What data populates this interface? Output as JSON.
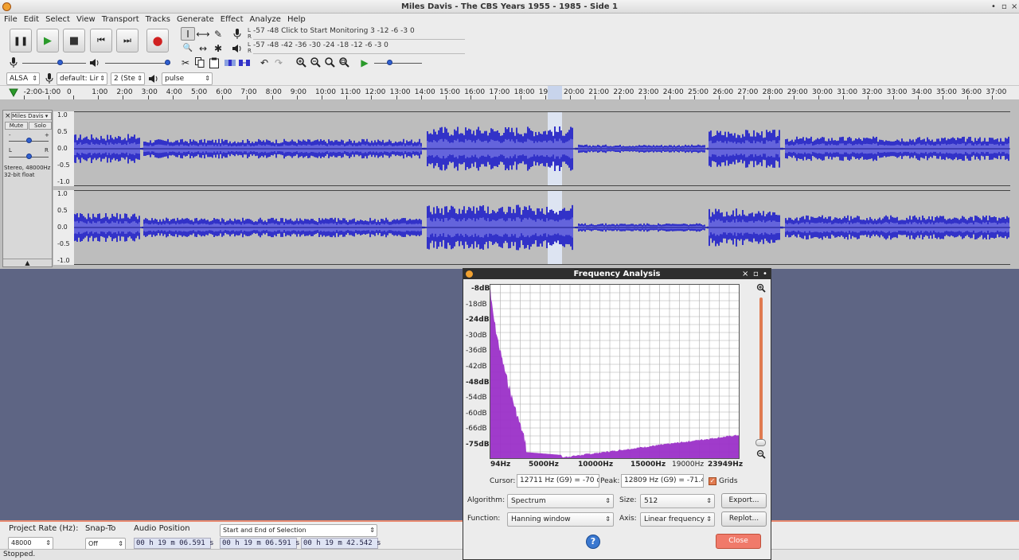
{
  "window": {
    "title": "Miles Davis - The CBS Years 1955 - 1985 - Side 1",
    "controls": [
      "•",
      "▫",
      "×"
    ]
  },
  "menu": [
    "File",
    "Edit",
    "Select",
    "View",
    "Transport",
    "Tracks",
    "Generate",
    "Effect",
    "Analyze",
    "Help"
  ],
  "transport": {
    "pause": "❚❚",
    "play": "▶",
    "stop": "■",
    "skip_start": "⏮",
    "skip_end": "⏭",
    "record": "●"
  },
  "tools": {
    "select": "I",
    "envelope": "⟷",
    "draw": "✎",
    "zoom": "🔍",
    "timeshift": "↔",
    "multi": "✱"
  },
  "meters": {
    "record_scale": "-57     -48     Click to Start Monitoring 3     -12     -6   -3  0",
    "play_scale": "-57     -48     -42     -36     -30     -24     -18     -12     -6   -3  0",
    "l": "L",
    "r": "R"
  },
  "device": {
    "host": "ALSA",
    "input": "default: Lir",
    "channels": "2 (Ste",
    "output": "pulse"
  },
  "ruler": {
    "ticks": [
      "-2:00",
      "-1:00",
      "0",
      "1:00",
      "2:00",
      "3:00",
      "4:00",
      "5:00",
      "6:00",
      "7:00",
      "8:00",
      "9:00",
      "10:00",
      "11:00",
      "12:00",
      "13:00",
      "14:00",
      "15:00",
      "16:00",
      "17:00",
      "18:00",
      "19:00",
      "20:00",
      "21:00",
      "22:00",
      "23:00",
      "24:00",
      "25:00",
      "26:00",
      "27:00",
      "28:00",
      "29:00",
      "30:00",
      "31:00",
      "32:00",
      "33:00",
      "34:00",
      "35:00",
      "36:00",
      "37:00"
    ]
  },
  "track": {
    "name": "Miles Davis",
    "mute": "Mute",
    "solo": "Solo",
    "gain_minus": "-",
    "gain_plus": "+",
    "pan_l": "L",
    "pan_r": "R",
    "info1": "Stereo, 48000Hz",
    "info2": "32-bit float",
    "collapse": "▲",
    "scale": [
      "1.0",
      "0.5",
      "0.0",
      "-0.5",
      "-1.0"
    ]
  },
  "bottom": {
    "project_rate_label": "Project Rate (Hz):",
    "project_rate": "48000",
    "snap_label": "Snap-To",
    "snap": "Off",
    "audio_pos_label": "Audio Position",
    "audio_pos": "00 h 19 m 06.591 s",
    "selection_mode": "Start and End of Selection",
    "sel_start": "00 h 19 m 06.591 s",
    "sel_end": "00 h 19 m 42.542 s"
  },
  "status": "Stopped.",
  "dialog": {
    "title": "Frequency Analysis",
    "y_labels": [
      "-8dB",
      "-18dB",
      "-24dB",
      "-30dB",
      "-36dB",
      "-42dB",
      "-48dB",
      "-54dB",
      "-60dB",
      "-66dB",
      "-75dB"
    ],
    "x_labels": [
      "94Hz",
      "5000Hz",
      "10000Hz",
      "15000Hz",
      "19000Hz",
      "23949Hz"
    ],
    "cursor_label": "Cursor:",
    "cursor_value": "12711 Hz (G9) = -70 d",
    "peak_label": "Peak:",
    "peak_value": "12809 Hz (G9) = -71.4",
    "grids_label": "Grids",
    "algorithm_label": "Algorithm:",
    "algorithm": "Spectrum",
    "size_label": "Size:",
    "size": "512",
    "function_label": "Function:",
    "function": "Hanning window",
    "axis_label": "Axis:",
    "axis": "Linear frequency",
    "export": "Export...",
    "replot": "Replot...",
    "help": "?",
    "close": "Close",
    "color": "#9b30c8"
  },
  "colors": {
    "waveform": "#3232c8",
    "waveform_rms": "#6464dc",
    "accent": "#e88a70"
  }
}
